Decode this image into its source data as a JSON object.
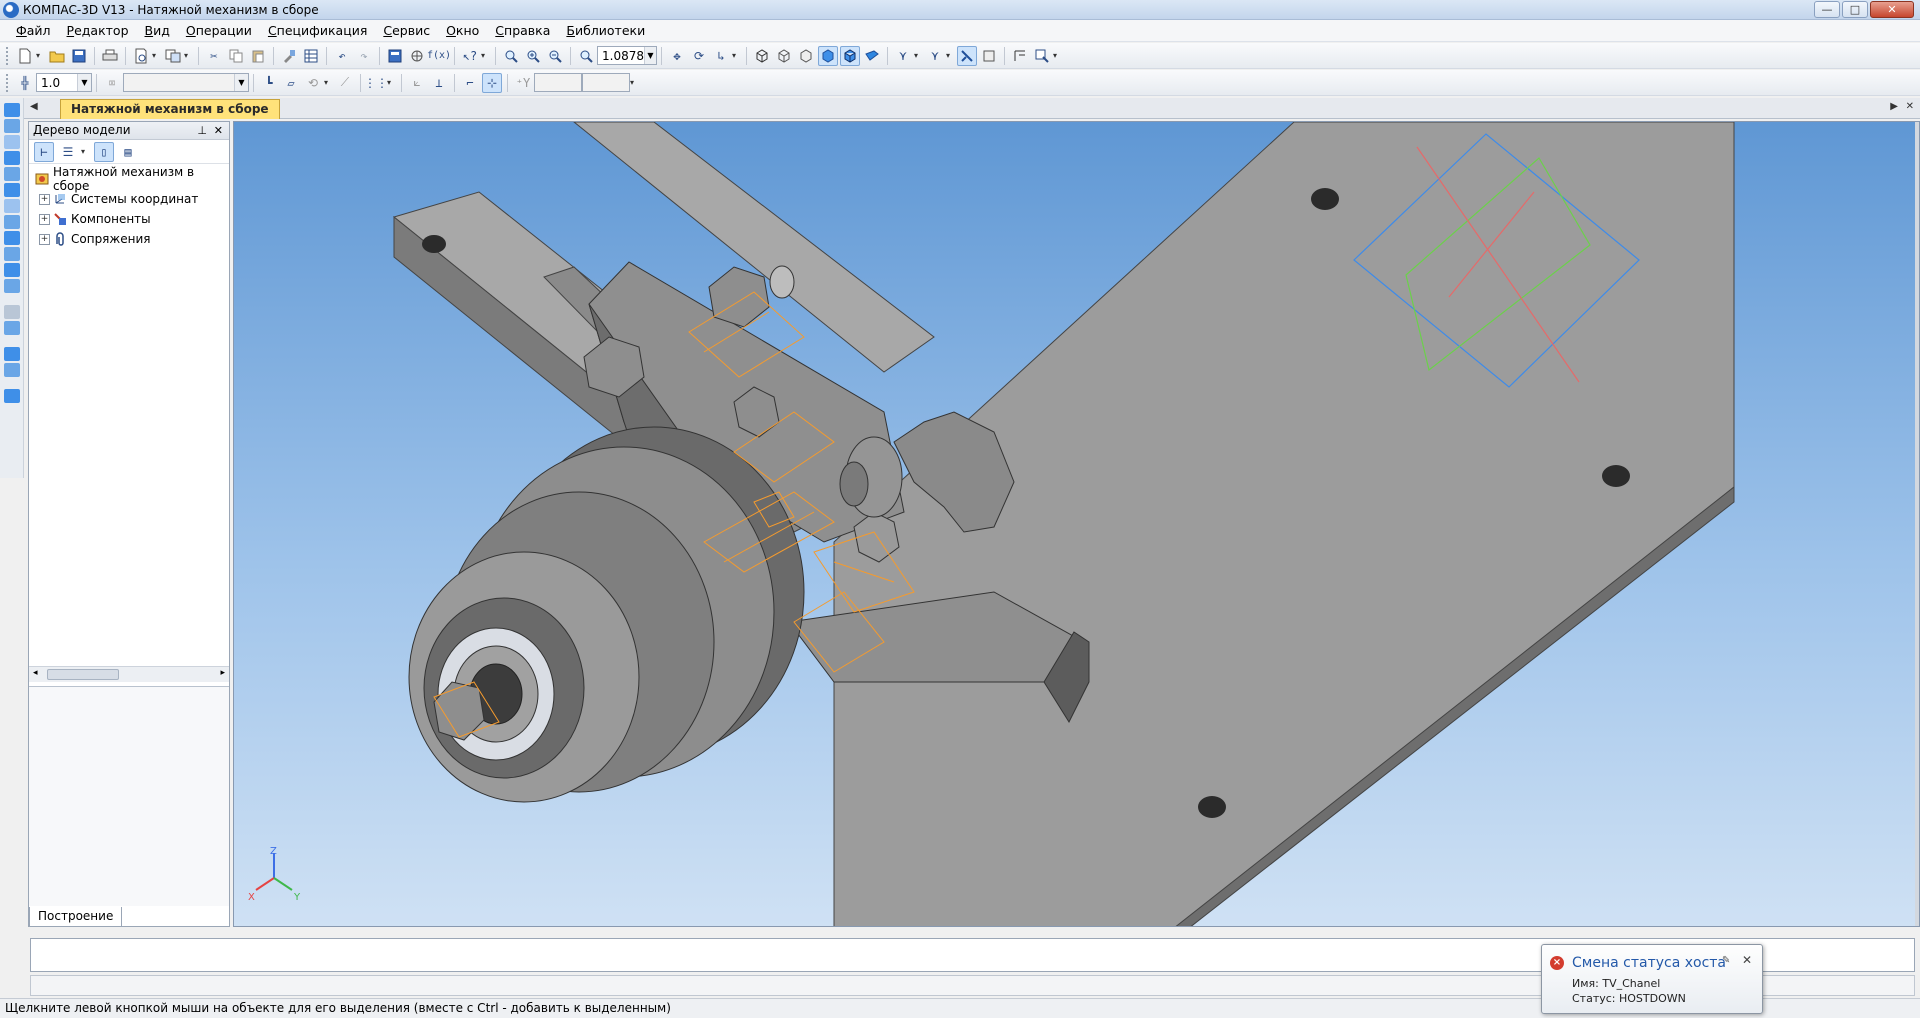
{
  "window": {
    "title": "КОМПАС-3D V13 - Натяжной механизм в сборе",
    "minimize": "—",
    "maximize": "□",
    "close": "✕"
  },
  "menu": [
    "Файл",
    "Редактор",
    "Вид",
    "Операции",
    "Спецификация",
    "Сервис",
    "Окно",
    "Справка",
    "Библиотеки"
  ],
  "toolbar1": {
    "zoom_value": "1.0878"
  },
  "toolbar2": {
    "scale_value": "1.0",
    "style_value": ""
  },
  "document_tab": {
    "title": "Натяжной механизм в сборе"
  },
  "tree": {
    "header": "Дерево модели",
    "root": "Натяжной механизм в сборе",
    "children": [
      "Системы координат",
      "Компоненты",
      "Сопряжения"
    ],
    "bottom_tab": "Построение"
  },
  "axes": {
    "x": "X",
    "y": "Y",
    "z": "Z"
  },
  "status_text": "Щелкните левой кнопкой мыши на объекте для его выделения (вместе с Ctrl - добавить к выделенным)",
  "notification": {
    "title": "Смена статуса хоста",
    "name_line": "Имя: TV_Chanel",
    "status_line": "Статус: HOSTDOWN"
  },
  "colors": {
    "active_tab": "#ffe27a",
    "viewport_top": "#5f97d4",
    "viewport_bottom": "#cfe1f4",
    "part_gray": "#9a9a9a",
    "hidden_edges": "#f59b2e",
    "plane_blue": "#3d8bea",
    "plane_green": "#6bd14a",
    "plane_red": "#e56a6a"
  }
}
